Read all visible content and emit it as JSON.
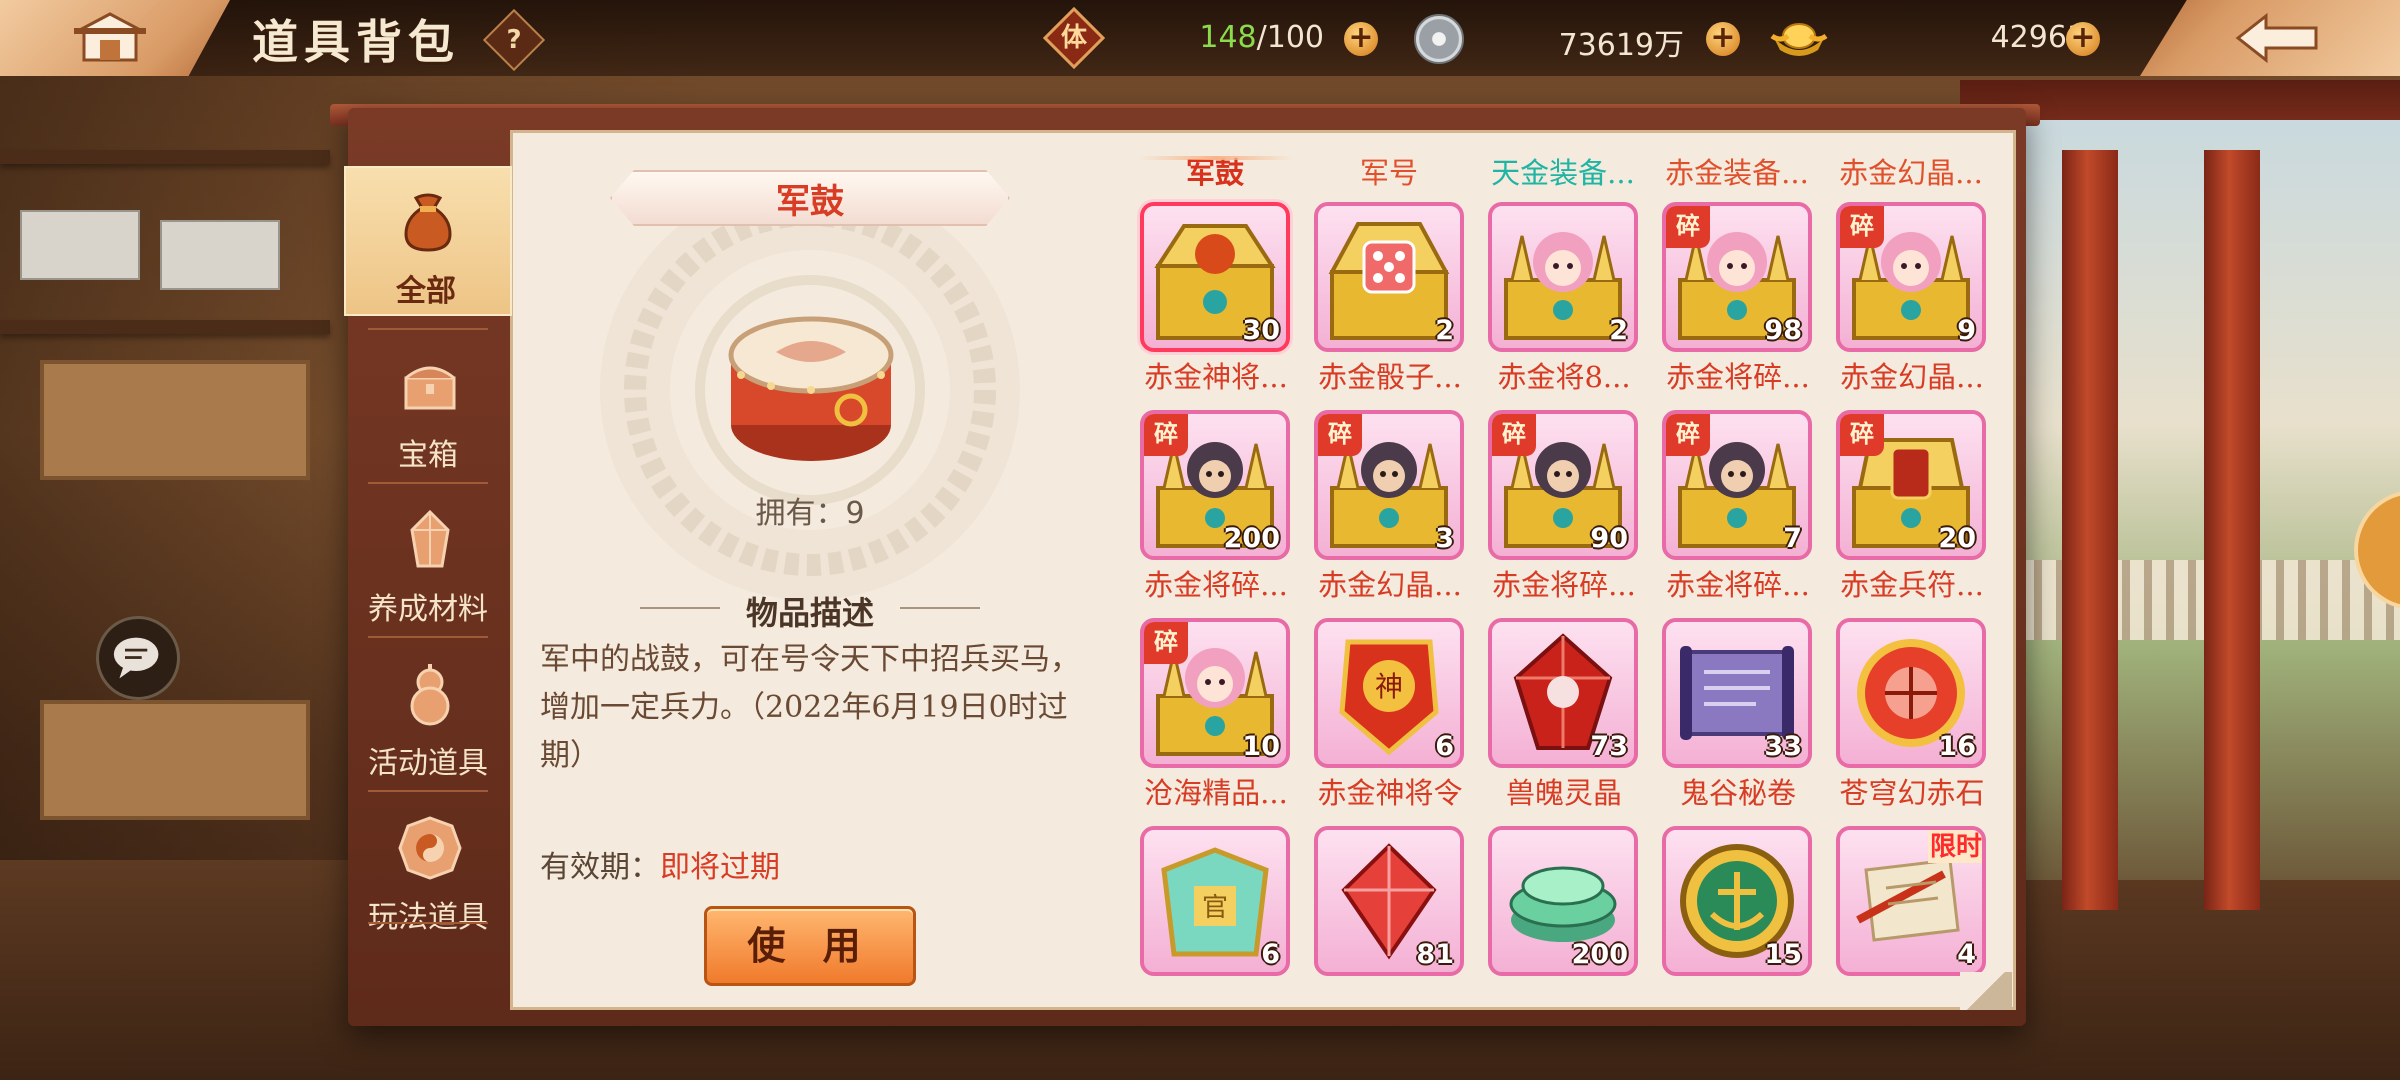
{
  "header": {
    "title": "道具背包",
    "help_label": "?",
    "stamina_icon_label": "体",
    "stamina_current": "148",
    "stamina_max": "/100",
    "silver": "73619万",
    "gold": "42961",
    "plus_label": "+"
  },
  "sidebar": {
    "items": [
      {
        "label": "全部",
        "icon": "money-bag-icon",
        "active": true
      },
      {
        "label": "宝箱",
        "icon": "chest-icon",
        "active": false
      },
      {
        "label": "养成材料",
        "icon": "crystal-icon",
        "active": false
      },
      {
        "label": "活动道具",
        "icon": "gourd-icon",
        "active": false
      },
      {
        "label": "玩法道具",
        "icon": "bagua-icon",
        "active": false
      }
    ]
  },
  "detail": {
    "name": "军鼓",
    "owned": "拥有：9",
    "desc_header": "物品描述",
    "description": "军中的战鼓，可在号令天下中招兵买马，增加一定兵力。（2022年6月19日0时过期）",
    "expiry_label": "有效期：",
    "expiry_value": "即将过期",
    "use_button": "使 用"
  },
  "tabs": [
    "军鼓",
    "军号",
    "天金装备...",
    "赤金装备...",
    "赤金幻晶..."
  ],
  "fragment_label": "碎",
  "limited_label": "限时",
  "items": [
    {
      "label": "赤金神将...",
      "count": "30",
      "frag": false,
      "art": "chest-dragon"
    },
    {
      "label": "赤金骰子...",
      "count": "2",
      "frag": false,
      "art": "chest-dice"
    },
    {
      "label": "赤金将8...",
      "count": "2",
      "frag": false,
      "art": "chest-girl"
    },
    {
      "label": "赤金将碎...",
      "count": "98",
      "frag": true,
      "art": "chest-girl"
    },
    {
      "label": "赤金幻晶...",
      "count": "9",
      "frag": true,
      "art": "chest-girl"
    },
    {
      "label": "赤金将碎...",
      "count": "200",
      "frag": true,
      "art": "chest-warrior"
    },
    {
      "label": "赤金幻晶...",
      "count": "3",
      "frag": true,
      "art": "chest-warrior"
    },
    {
      "label": "赤金将碎...",
      "count": "90",
      "frag": true,
      "art": "chest-warrior"
    },
    {
      "label": "赤金将碎...",
      "count": "7",
      "frag": true,
      "art": "chest-warrior"
    },
    {
      "label": "赤金兵符...",
      "count": "20",
      "frag": true,
      "art": "chest-token"
    },
    {
      "label": "沧海精品...",
      "count": "10",
      "frag": true,
      "art": "chest-girl"
    },
    {
      "label": "赤金神将令",
      "count": "6",
      "frag": false,
      "art": "dragon-token"
    },
    {
      "label": "兽魄灵晶",
      "count": "73",
      "frag": false,
      "art": "red-crystal"
    },
    {
      "label": "鬼谷秘卷",
      "count": "33",
      "frag": false,
      "art": "scroll"
    },
    {
      "label": "苍穹幻赤石",
      "count": "16",
      "frag": false,
      "art": "red-orb"
    },
    {
      "label": "",
      "count": "6",
      "frag": false,
      "art": "jade-armor"
    },
    {
      "label": "",
      "count": "81",
      "frag": false,
      "art": "red-gem"
    },
    {
      "label": "",
      "count": "200",
      "frag": false,
      "art": "jade-coin"
    },
    {
      "label": "",
      "count": "15",
      "frag": false,
      "art": "anchor-coin"
    },
    {
      "label": "",
      "count": "4",
      "frag": false,
      "art": "paper-scroll",
      "limited": true
    }
  ],
  "colors": {
    "accent_red": "#d83c24",
    "frame_brown": "#7a3a26",
    "parchment": "#f4ebde",
    "item_border_pink": "#e86aa6",
    "stamina_green": "#8bdc4c"
  }
}
